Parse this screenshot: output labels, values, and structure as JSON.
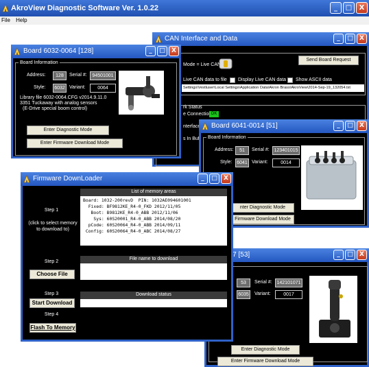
{
  "app": {
    "title": "AkroView Diagnostic Software Ver. 1.0.22",
    "menu": [
      "File",
      "Help"
    ],
    "min": "_",
    "max": "□",
    "close": "X"
  },
  "can_window": {
    "title": "CAN Interface and Data",
    "mode_label": "Mode = Live CAN",
    "send_request": "Send Board Request",
    "live_to_file": "Live CAN data to file",
    "display_live": "Display Live CAN data",
    "show_ascii": "Show ASCII data",
    "path": "Settings\\Vestluser\\Local Settings\\Application Data\\Akron Brass\\AkroView\\2014-Sep-19_132054.txt",
    "work_status": "rk Status",
    "connection": "e Connection",
    "connection_ok": "OK",
    "interface_st": "nterface St",
    "in_buffer": "s In Buffe"
  },
  "board1": {
    "title": "Board 6032-0064 [128]",
    "group": "Board Information",
    "address_label": "Address:",
    "address": "128",
    "serial_label": "Serial #:",
    "serial": "94501001",
    "style_label": "Style:",
    "style": "6032",
    "variant_label": "Variant:",
    "variant": "0064",
    "library": "Library file 6032-0064.CFG v2014.9.11.0",
    "desc1": "3351 Tuckaway with analog sensors",
    "desc2": "(E-Drive special boom control)",
    "diag_btn": "Enter Diagnostic Mode",
    "fw_btn": "Enter Firmware Download Mode"
  },
  "board2": {
    "title": "Board 6041-0014 [51]",
    "group": "Board Information",
    "address_label": "Address:",
    "address": "51",
    "serial_label": "Serial #:",
    "serial": "123401015",
    "style_label": "Style:",
    "style": "6041",
    "variant_label": "Variant:",
    "variant": "0014",
    "diag_btn": "nter Diagnostic Mode",
    "fw_btn": "Firmware Download Mode"
  },
  "board3": {
    "title": "35-0017 [53]",
    "group": "ation",
    "address": "53",
    "serial_label": "Serial #:",
    "serial": "142101071",
    "style": "6035",
    "variant_label": "Variant:",
    "variant": "0017",
    "diag_btn": "Enter Diagnostic Mode",
    "fw_btn": "Enter Firmware Download Mode"
  },
  "firmware": {
    "title": "Firmware DownLoader",
    "list_header": "List of memory areas",
    "memory_areas": "Board: 1032-200revD  PIN: 1032AE094601001\n  Fixed: BF9812KE_R4-0_FKD 2012/11/05\n   Boot: B9812KE_R4-0_ABB 2012/11/06\n    Sys: 60S20001_R4-0_ABB 2014/08/20\n  pCode: 60S20064_R4-0_ABB 2014/09/11\n Config: 60S20064_R4-0_ABC 2014/08/27",
    "step1": "Step 1",
    "step1_hint": "(click to select memory to download to)",
    "step2": "Step 2",
    "choose_file": "Choose File",
    "file_header": "File name to download",
    "step3": "Step 3",
    "start_download": "Start Download",
    "status_header": "Download status",
    "step4": "Step 4",
    "flash": "Flash To Memory"
  },
  "colors": {
    "titlebar": "#2457c0",
    "window_body": "#000000",
    "ok_green": "#19c419",
    "close_red": "#c43a1c"
  }
}
